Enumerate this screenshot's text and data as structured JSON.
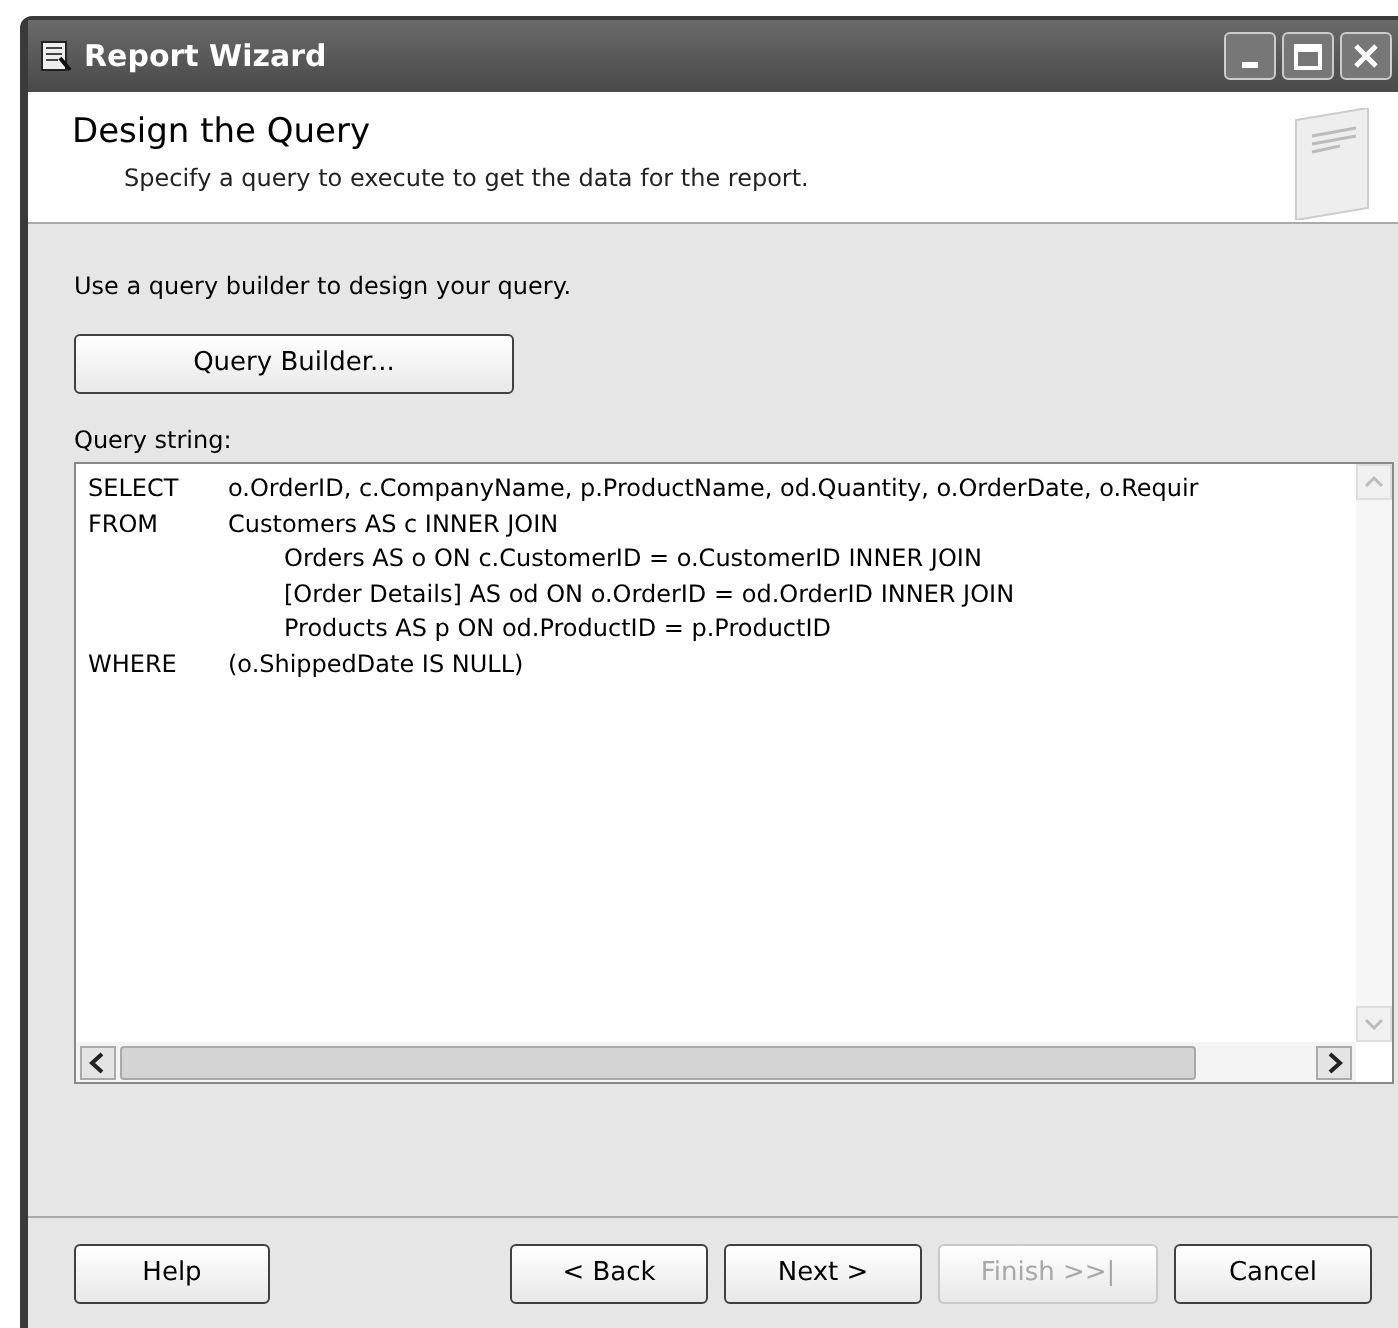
{
  "window": {
    "title": "Report Wizard"
  },
  "header": {
    "title": "Design the Query",
    "subtitle": "Specify a query to execute to get the data for the report."
  },
  "instruction": "Use a query builder to design your query.",
  "query_builder_button": {
    "label": "Query Builder..."
  },
  "query_string": {
    "label": "Query string:",
    "lines": [
      {
        "keyword": "SELECT",
        "text": "o.OrderID, c.CompanyName, p.ProductName, od.Quantity, o.OrderDate, o.Requir"
      },
      {
        "keyword": "FROM",
        "text": "Customers AS c INNER JOIN"
      },
      {
        "text": "Orders AS o ON c.CustomerID = o.CustomerID INNER JOIN"
      },
      {
        "text": "[Order Details] AS od ON o.OrderID = od.OrderID INNER JOIN"
      },
      {
        "text": "Products AS p ON od.ProductID = p.ProductID"
      },
      {
        "keyword": "WHERE",
        "text": "(o.ShippedDate IS NULL)"
      }
    ]
  },
  "buttons": [
    {
      "label": "Help",
      "disabled": false
    },
    {
      "label": "< Back",
      "disabled": false
    },
    {
      "label": "Next >",
      "disabled": false
    },
    {
      "label": "Finish >>|",
      "disabled": true
    },
    {
      "label": "Cancel",
      "disabled": false
    }
  ]
}
